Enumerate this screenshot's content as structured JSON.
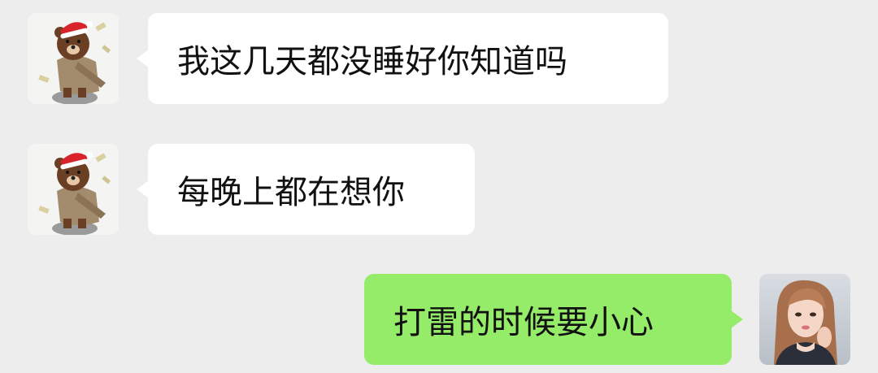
{
  "messages": [
    {
      "sender": "contact",
      "avatar": "brown-bear-santa-hat-avatar",
      "text": "我这几天都没睡好你知道吗"
    },
    {
      "sender": "contact",
      "avatar": "brown-bear-santa-hat-avatar",
      "text": "每晚上都在想你"
    },
    {
      "sender": "self",
      "avatar": "girl-portrait-avatar",
      "text": "打雷的时候要小心"
    }
  ],
  "colors": {
    "background": "#ededed",
    "incoming_bubble": "#ffffff",
    "outgoing_bubble": "#95ec69"
  }
}
